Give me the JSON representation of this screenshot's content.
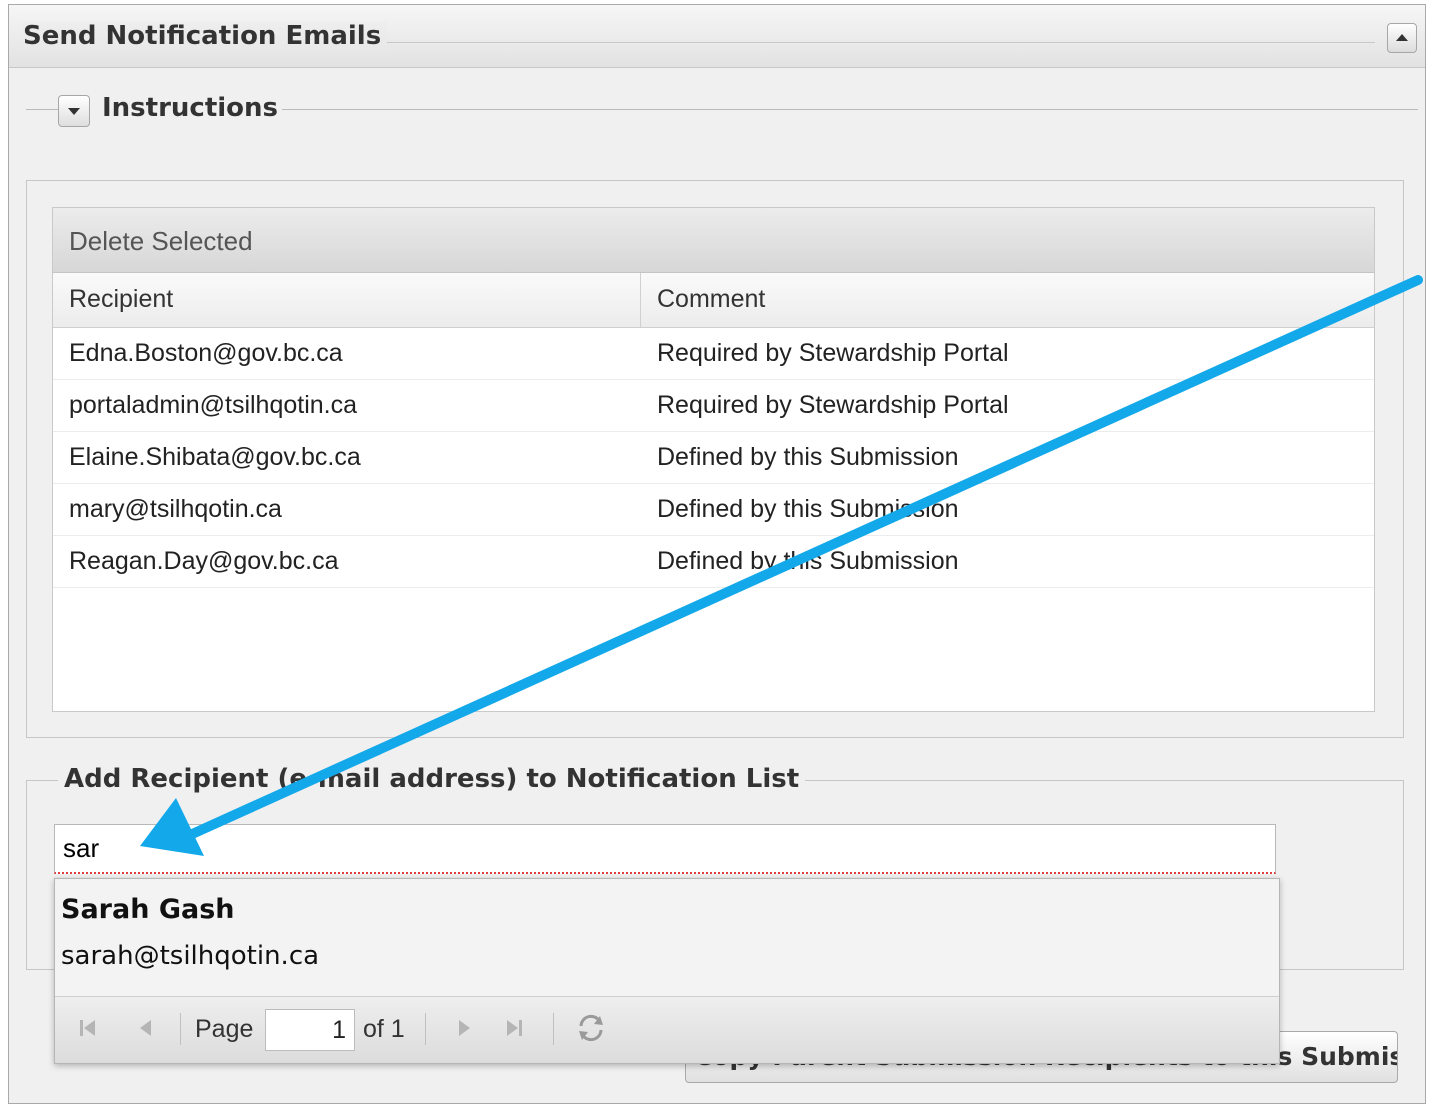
{
  "panel": {
    "title": "Send Notification Emails"
  },
  "instructions": {
    "label": "Instructions"
  },
  "grid": {
    "toolbar": {
      "delete_label": "Delete Selected"
    },
    "columns": [
      "Recipient",
      "Comment"
    ],
    "rows": [
      {
        "recipient": "Edna.Boston@gov.bc.ca",
        "comment": "Required by Stewardship Portal"
      },
      {
        "recipient": "portaladmin@tsilhqotin.ca",
        "comment": "Required by Stewardship Portal"
      },
      {
        "recipient": "Elaine.Shibata@gov.bc.ca",
        "comment": "Defined by this Submission"
      },
      {
        "recipient": "mary@tsilhqotin.ca",
        "comment": "Defined by this Submission"
      },
      {
        "recipient": "Reagan.Day@gov.bc.ca",
        "comment": "Defined by this Submission"
      }
    ]
  },
  "add_recipient": {
    "legend": "Add Recipient (e-mail address) to Notification List",
    "input_value": "sar"
  },
  "suggestions": {
    "items": [
      {
        "name": "Sarah Gash",
        "email": "sarah@tsilhqotin.ca"
      }
    ],
    "pager": {
      "page_label": "Page",
      "current_page": "1",
      "of_label": "of 1"
    }
  },
  "copy_button": {
    "label": "Copy Parent Submission Recipients to this Submission"
  },
  "colors": {
    "annotation_arrow": "#12a8ea",
    "error_underline": "#e04040"
  }
}
